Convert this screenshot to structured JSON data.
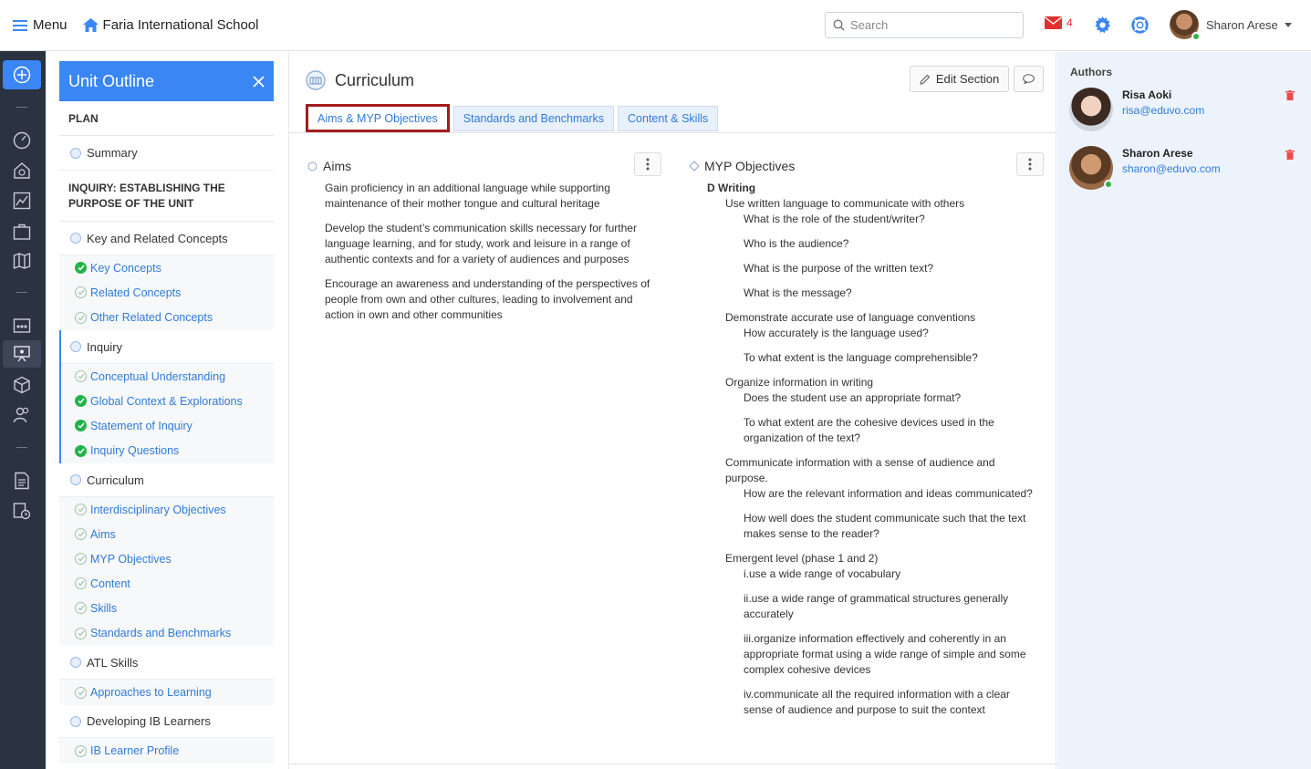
{
  "topbar": {
    "menu_label": "Menu",
    "school_name": "Faria International School",
    "search_placeholder": "Search",
    "mail_count": "4",
    "user_name": "Sharon Arese"
  },
  "outline": {
    "title": "Unit Outline",
    "plan_header": "PLAN",
    "summary": "Summary",
    "inquiry_header": "INQUIRY: ESTABLISHING THE PURPOSE OF THE UNIT",
    "sections": [
      {
        "label": "Key and Related Concepts",
        "items": [
          {
            "label": "Key Concepts",
            "done": true
          },
          {
            "label": "Related Concepts",
            "done": false
          },
          {
            "label": "Other Related Concepts",
            "done": false
          }
        ]
      },
      {
        "label": "Inquiry",
        "items": [
          {
            "label": "Conceptual Understanding",
            "done": false
          },
          {
            "label": "Global Context & Explorations",
            "done": true
          },
          {
            "label": "Statement of Inquiry",
            "done": true
          },
          {
            "label": "Inquiry Questions",
            "done": true
          }
        ]
      },
      {
        "label": "Curriculum",
        "items": [
          {
            "label": "Interdisciplinary Objectives",
            "done": false
          },
          {
            "label": "Aims",
            "done": false
          },
          {
            "label": "MYP Objectives",
            "done": false
          },
          {
            "label": "Content",
            "done": false
          },
          {
            "label": "Skills",
            "done": false
          },
          {
            "label": "Standards and Benchmarks",
            "done": false
          }
        ]
      },
      {
        "label": "ATL Skills",
        "items": [
          {
            "label": "Approaches to Learning",
            "done": false
          }
        ]
      },
      {
        "label": "Developing IB Learners",
        "items": [
          {
            "label": "IB Learner Profile",
            "done": false
          }
        ]
      }
    ]
  },
  "main": {
    "title": "Curriculum",
    "edit_label": "Edit Section",
    "tabs": [
      "Aims & MYP Objectives",
      "Standards and Benchmarks",
      "Content & Skills"
    ],
    "aims": {
      "title": "Aims",
      "paragraphs": [
        "Gain proficiency in an additional language while supporting maintenance of their mother tongue and cultural heritage",
        "Develop the student’s communication skills necessary for further language learning, and for study, work and leisure in a range of authentic contexts and for a variety of audiences and purposes",
        "Encourage an awareness and understanding of the perspectives of people from own and other cultures, leading to involvement and action in own and other communities"
      ]
    },
    "objectives": {
      "title": "MYP Objectives",
      "criterion": "D Writing",
      "groups": [
        {
          "label": "Use written language to communicate with others",
          "items": [
            "What is the role of the student/writer?",
            "Who is the audience?",
            "What is the purpose of the written text?",
            "What is the message?"
          ]
        },
        {
          "label": "Demonstrate accurate use of language conventions",
          "items": [
            "How accurately is the language used?",
            "To what extent is the language comprehensible?"
          ]
        },
        {
          "label": "Organize information in writing",
          "items": [
            "Does the student use an appropriate format?",
            "To what extent are the cohesive devices used in the organization of the text?"
          ]
        },
        {
          "label": "Communicate information with a sense of audience and purpose.",
          "items": [
            "How are the relevant information and ideas communicated?",
            "How well does the student communicate such that the text makes sense to the reader?"
          ]
        },
        {
          "label": "Emergent level (phase 1 and 2)",
          "items": [
            "i.use a wide range of vocabulary",
            "ii.use a wide range of grammatical structures generally accurately",
            "iii.organize information effectively and coherently in an appropriate format using a wide range of simple and some complex cohesive devices",
            "iv.communicate all the required information with a clear sense of audience and purpose to suit the context"
          ]
        }
      ]
    }
  },
  "authors": {
    "title": "Authors",
    "list": [
      {
        "name": "Risa Aoki",
        "email": "risa@eduvo.com"
      },
      {
        "name": "Sharon Arese",
        "email": "sharon@eduvo.com"
      }
    ]
  },
  "colors": {
    "accent": "#3a86f5",
    "active_tab_border": "#a31d1d",
    "done": "#23b34b",
    "link": "#2f7bd6"
  }
}
